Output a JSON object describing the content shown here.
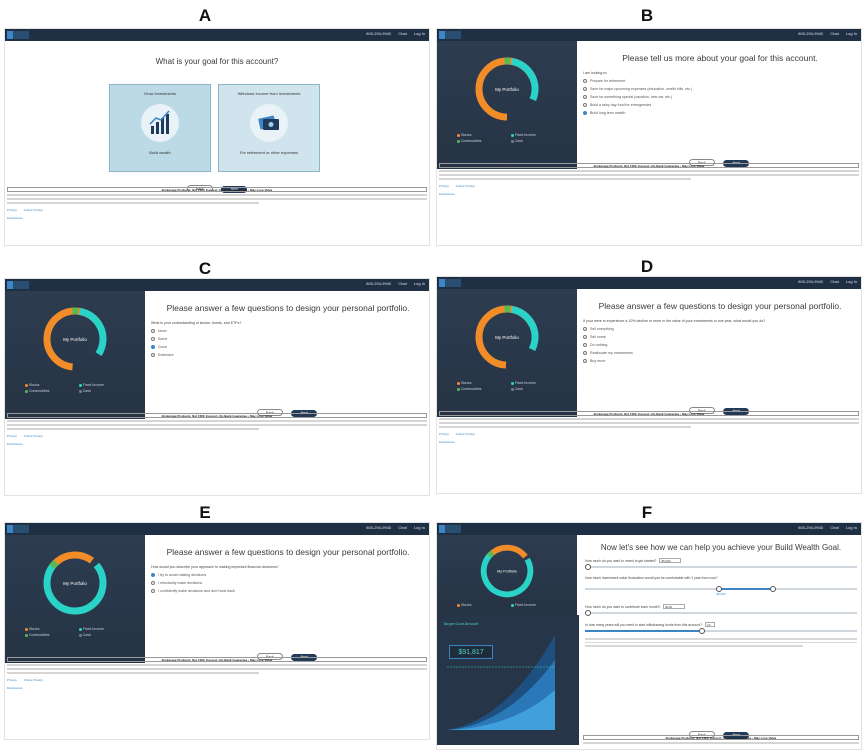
{
  "letters": [
    "A",
    "B",
    "C",
    "D",
    "E",
    "F"
  ],
  "topbar": {
    "phone": "800-294-9940",
    "chat": "Chat",
    "login": "Log In"
  },
  "buttons": {
    "back": "Back",
    "next": "Next"
  },
  "footer": {
    "disclaimer": "Brokerage Products: Not FDIC Insured • No Bank Guarantee • May Lose Value",
    "links": [
      "Privacy",
      "Online Privacy",
      "Disclosures"
    ]
  },
  "portfolio": {
    "label": "My Portfolio",
    "legend": [
      "Stocks",
      "Fixed Income",
      "Commodities",
      "Cash"
    ],
    "colors": {
      "stocks": "#f28c28",
      "fixed": "#29d3c7",
      "commod": "#5ab858",
      "cash": "#6b7f95"
    }
  },
  "panelA": {
    "title": "What is your goal for this account?",
    "card1_title": "Grow Investments",
    "card1_sub": "Build wealth",
    "card2_title": "Withdraw Income from Investments",
    "card2_sub": "For retirement or other expenses"
  },
  "panelB": {
    "title": "Please tell us more about your goal for this account.",
    "question": "I am looking to:",
    "options": [
      "Prepare for retirement",
      "Save for major upcoming expenses (education, health bills, etc.)",
      "Save for something special (vacation, new car, etc.)",
      "Build a rainy day fund for emergencies",
      "Build long term wealth"
    ]
  },
  "panelC": {
    "title": "Please answer a few questions to design your personal portfolio.",
    "question": "What is your understanding of stocks, bonds, and ETFs?",
    "options": [
      "None",
      "Some",
      "Good",
      "Extensive"
    ]
  },
  "panelD": {
    "title": "Please answer a few questions to design your personal portfolio.",
    "question": "If your were to experience a 10% decline or more in the value of your investments in one year, what would you do?",
    "options": [
      "Sell everything",
      "Sell some",
      "Do nothing",
      "Reallocate my investments",
      "Buy more"
    ]
  },
  "panelE": {
    "title": "Please answer a few questions to design your personal portfolio.",
    "question": "How would you describe your approach to making important financial decisions?",
    "options": [
      "I try to avoid making decisions",
      "I reluctantly make decisions",
      "I confidently make decisions and don't look back"
    ]
  },
  "panelF": {
    "title": "Now let's see how we can help you achieve your Build Wealth Goal.",
    "q1": "How much do you want to invest to get started?",
    "q1_value": "$5,000",
    "q2": "How much investment value fluctuation would you be comfortable with 1 year from now?",
    "q2_value": "$5,000",
    "q3": "How much do you want to contribute each month?",
    "q3_value": "$100",
    "q4": "In how many years will you need to start withdrawing funds from this account?",
    "q4_value": "20",
    "chart_label": "Target Goal Amount",
    "chart_value": "$91,817"
  }
}
